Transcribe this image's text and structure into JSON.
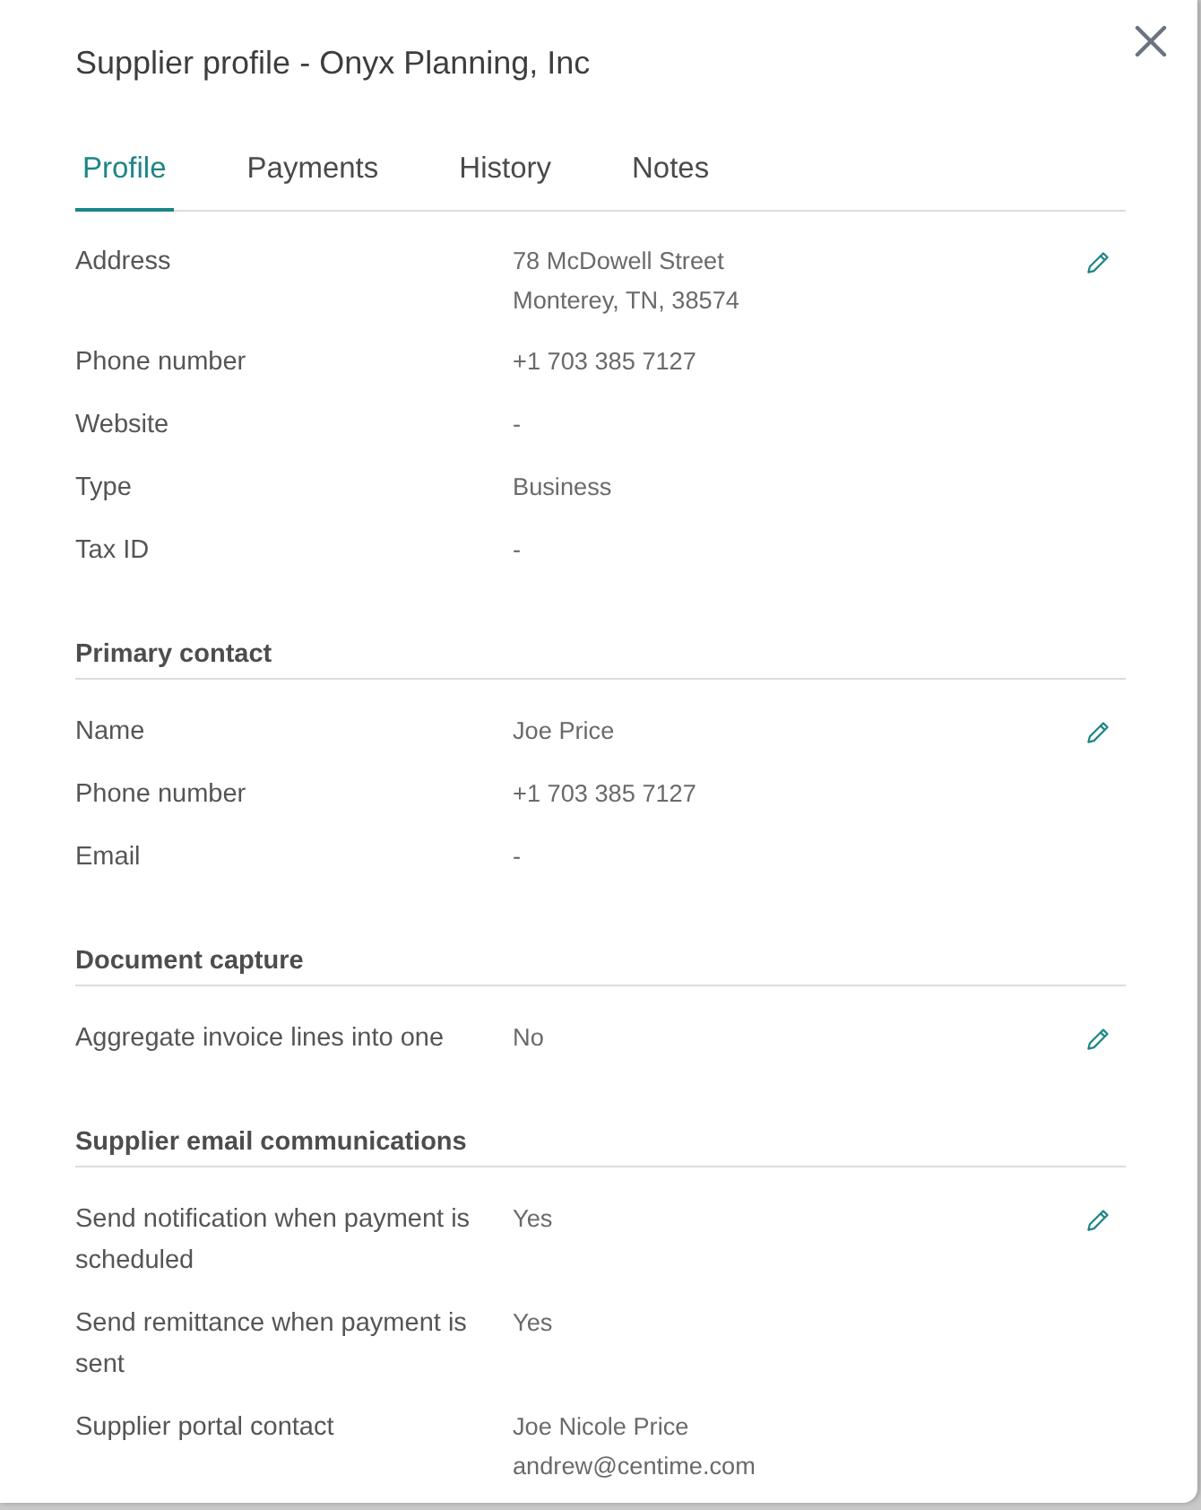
{
  "dialog": {
    "title": "Supplier profile - Onyx Planning, Inc"
  },
  "tabs": [
    {
      "label": "Profile",
      "selected": true
    },
    {
      "label": "Payments",
      "selected": false
    },
    {
      "label": "History",
      "selected": false
    },
    {
      "label": "Notes",
      "selected": false
    }
  ],
  "sections": [
    {
      "editable": true,
      "fields": [
        {
          "label": "Address",
          "value": [
            "78 McDowell Street",
            "Monterey, TN, 38574"
          ]
        },
        {
          "label": "Phone number",
          "value": [
            "+1 703 385 7127"
          ]
        },
        {
          "label": "Website",
          "value": [
            "-"
          ]
        },
        {
          "label": "Type",
          "value": [
            "Business"
          ]
        },
        {
          "label": "Tax ID",
          "value": [
            "-"
          ]
        }
      ]
    },
    {
      "heading": "Primary contact",
      "editable": true,
      "fields": [
        {
          "label": "Name",
          "value": [
            "Joe Price"
          ]
        },
        {
          "label": "Phone number",
          "value": [
            "+1 703 385 7127"
          ]
        },
        {
          "label": "Email",
          "value": [
            "-"
          ]
        }
      ]
    },
    {
      "heading": "Document capture",
      "editable": true,
      "fields": [
        {
          "label": "Aggregate invoice lines into one",
          "value": [
            "No"
          ]
        }
      ]
    },
    {
      "heading": "Supplier email communications",
      "editable": true,
      "fields": [
        {
          "label": "Send notification when payment is scheduled",
          "value": [
            "Yes"
          ]
        },
        {
          "label": "Send remittance when payment is sent",
          "value": [
            "Yes"
          ]
        },
        {
          "label": "Supplier portal contact",
          "value": [
            "Joe Nicole Price",
            "andrew@centime.com"
          ]
        }
      ]
    }
  ]
}
